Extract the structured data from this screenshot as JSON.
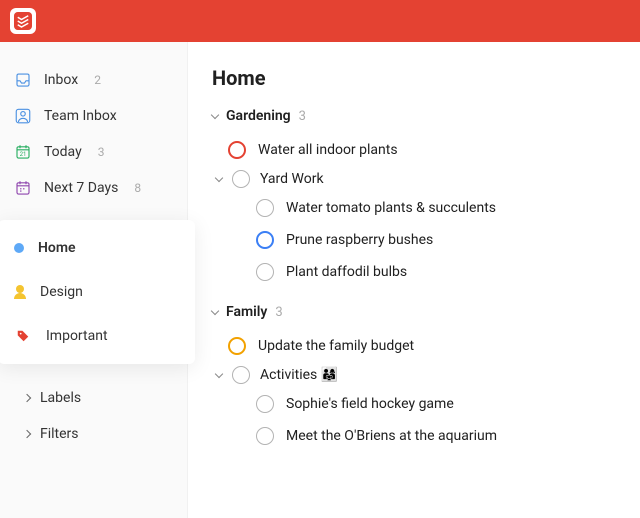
{
  "app": {
    "name": "Todoist"
  },
  "sidebar": {
    "nav": [
      {
        "label": "Inbox",
        "count": "2",
        "icon": "inbox-icon",
        "color": "#4a90e2"
      },
      {
        "label": "Team Inbox",
        "count": "",
        "icon": "team-inbox-icon",
        "color": "#4a90e2"
      },
      {
        "label": "Today",
        "count": "3",
        "icon": "calendar-today-icon",
        "color": "#27ae60"
      },
      {
        "label": "Next 7 Days",
        "count": "8",
        "icon": "calendar-week-icon",
        "color": "#8e44ad"
      }
    ],
    "favorites": [
      {
        "label": "Home",
        "icon": "project-dot-blue",
        "active": true
      },
      {
        "label": "Design",
        "icon": "person-icon",
        "active": false
      },
      {
        "label": "Important",
        "icon": "tag-icon",
        "active": false
      }
    ],
    "expandable": [
      {
        "label": "Labels"
      },
      {
        "label": "Filters"
      }
    ]
  },
  "page": {
    "title": "Home",
    "sections": [
      {
        "name": "Gardening",
        "count": "3",
        "tasks": [
          {
            "title": "Water all indoor plants",
            "priority": "red",
            "level": 0
          }
        ],
        "sub": {
          "name": "Yard Work",
          "tasks": [
            {
              "title": "Water tomato plants & succulents",
              "priority": "",
              "level": 1
            },
            {
              "title": "Prune raspberry bushes",
              "priority": "blue",
              "level": 1
            },
            {
              "title": "Plant daffodil bulbs",
              "priority": "",
              "level": 1
            }
          ]
        }
      },
      {
        "name": "Family",
        "count": "3",
        "tasks": [
          {
            "title": "Update the family budget",
            "priority": "orange",
            "level": 0
          }
        ],
        "sub": {
          "name": "Activities 👨‍👩‍👧",
          "tasks": [
            {
              "title": "Sophie's field hockey game",
              "priority": "",
              "level": 1
            },
            {
              "title": "Meet the O'Briens at the aquarium",
              "priority": "",
              "level": 1
            }
          ]
        }
      }
    ]
  }
}
